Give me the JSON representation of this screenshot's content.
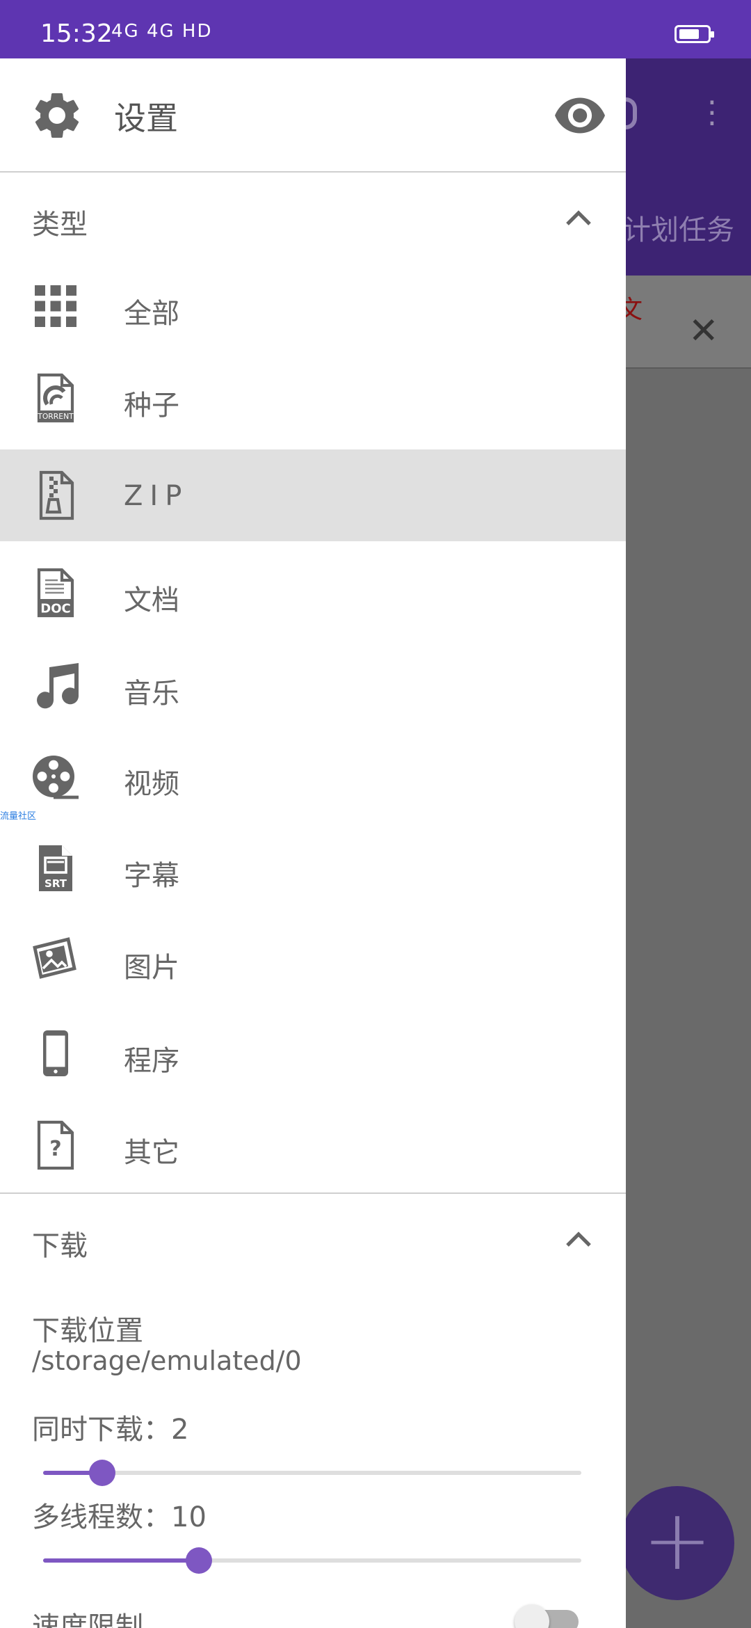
{
  "status_bar": {
    "time": "15:32",
    "signal_text": "4G 4G HD",
    "battery_icon": "battery-icon"
  },
  "background_app": {
    "tab_label": "计划任务",
    "notice_text": "文",
    "close_icon": "close-icon",
    "fab_icon": "plus-icon"
  },
  "drawer": {
    "header": {
      "title": "设置",
      "settings_icon": "gear-icon",
      "visibility_icon": "eye-icon"
    },
    "types_section": {
      "title": "类型",
      "items": [
        {
          "label": "全部",
          "icon": "grid-icon"
        },
        {
          "label": "种子",
          "icon": "torrent-icon"
        },
        {
          "label": "ZIP",
          "icon": "zip-icon"
        },
        {
          "label": "文档",
          "icon": "doc-icon"
        },
        {
          "label": "音乐",
          "icon": "music-icon"
        },
        {
          "label": "视频",
          "icon": "film-reel-icon"
        },
        {
          "label": "字幕",
          "icon": "srt-icon"
        },
        {
          "label": "图片",
          "icon": "image-icon"
        },
        {
          "label": "程序",
          "icon": "phone-icon"
        },
        {
          "label": "其它",
          "icon": "question-file-icon"
        }
      ],
      "selected_index": 2
    },
    "watermark": "流量社区",
    "download_section": {
      "title": "下载",
      "location_label": "下载位置",
      "location_value": "/storage/emulated/0",
      "concurrent_label": "同时下载：",
      "concurrent_value": "2",
      "concurrent_fraction": 0.11,
      "threads_label": "多线程数：",
      "threads_value": "10",
      "threads_fraction": 0.29,
      "speed_limit_label": "速度限制",
      "speed_limit_enabled": false
    }
  },
  "colors": {
    "accent": "#7e57c2",
    "status_bar": "#5e35b1"
  }
}
